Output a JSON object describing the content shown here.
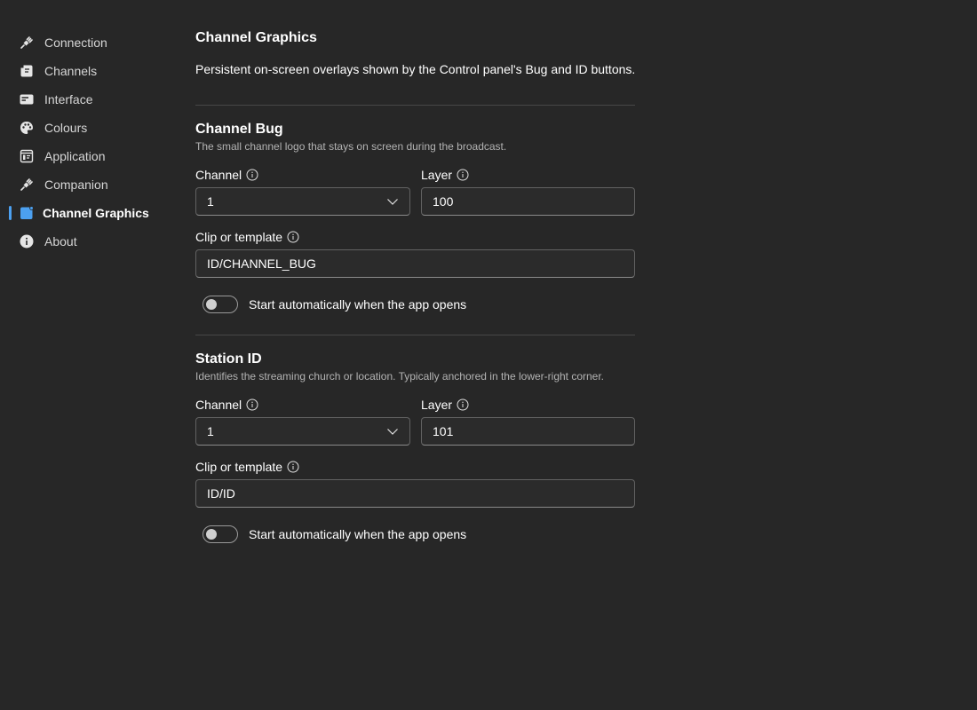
{
  "sidebar": {
    "items": [
      {
        "label": "Connection",
        "icon": "plug-icon",
        "active": false
      },
      {
        "label": "Channels",
        "icon": "channels-icon",
        "active": false
      },
      {
        "label": "Interface",
        "icon": "interface-icon",
        "active": false
      },
      {
        "label": "Colours",
        "icon": "palette-icon",
        "active": false
      },
      {
        "label": "Application",
        "icon": "application-icon",
        "active": false
      },
      {
        "label": "Companion",
        "icon": "plug-icon",
        "active": false
      },
      {
        "label": "Channel Graphics",
        "icon": "channel-graphics-icon",
        "active": true
      },
      {
        "label": "About",
        "icon": "info-circle-icon",
        "active": false
      }
    ]
  },
  "colors": {
    "accent": "#4ca0f0",
    "background": "#272727"
  },
  "page": {
    "title": "Channel Graphics",
    "description": "Persistent on-screen overlays shown by the Control panel's Bug and ID buttons."
  },
  "bug": {
    "title": "Channel Bug",
    "description": "The small channel logo that stays on screen during the broadcast.",
    "channel_label": "Channel",
    "channel_value": "1",
    "layer_label": "Layer",
    "layer_value": "100",
    "clip_label": "Clip or template",
    "clip_value": "ID/CHANNEL_BUG",
    "autostart_label": "Start automatically when the app opens",
    "autostart_on": false
  },
  "station": {
    "title": "Station ID",
    "description": "Identifies the streaming church or location. Typically anchored in the lower-right corner.",
    "channel_label": "Channel",
    "channel_value": "1",
    "layer_label": "Layer",
    "layer_value": "101",
    "clip_label": "Clip or template",
    "clip_value": "ID/ID",
    "autostart_label": "Start automatically when the app opens",
    "autostart_on": false
  }
}
